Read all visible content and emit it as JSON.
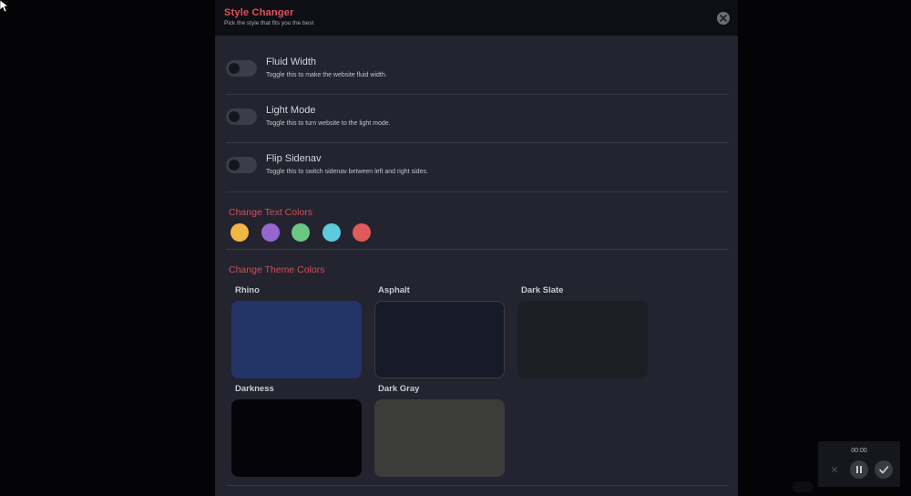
{
  "panel": {
    "title": "Style Changer",
    "subtitle": "Pick the style that fits you the best",
    "close_icon": "close-icon"
  },
  "options": [
    {
      "label": "Fluid Width",
      "description": "Toggle this to make the website fluid width.",
      "enabled": false
    },
    {
      "label": "Light Mode",
      "description": "Toggle this to turn website to the light mode.",
      "enabled": false
    },
    {
      "label": "Flip Sidenav",
      "description": "Toggle this to switch sidenav between left and right sides.",
      "enabled": false
    }
  ],
  "text_colors": {
    "title": "Change Text Colors",
    "swatches": [
      "#f2b643",
      "#9666cf",
      "#69c882",
      "#5ccbdc",
      "#e05a5a"
    ]
  },
  "theme_colors": {
    "title": "Change Theme Colors",
    "themes": [
      {
        "name": "Rhino",
        "color": "#233567"
      },
      {
        "name": "Asphalt",
        "color": "#171b29"
      },
      {
        "name": "Dark Slate",
        "color": "#1d1e24"
      },
      {
        "name": "Darkness",
        "color": "#050509"
      },
      {
        "name": "Dark Gray",
        "color": "#3c3c3a"
      }
    ]
  },
  "recorder": {
    "time": "00:00",
    "cancel_icon": "close-icon",
    "pause_icon": "pause-icon",
    "confirm_icon": "check-icon"
  },
  "colors": {
    "accent": "#e0525d",
    "panel_bg": "#23242f",
    "header_bg": "#0e0f15"
  }
}
